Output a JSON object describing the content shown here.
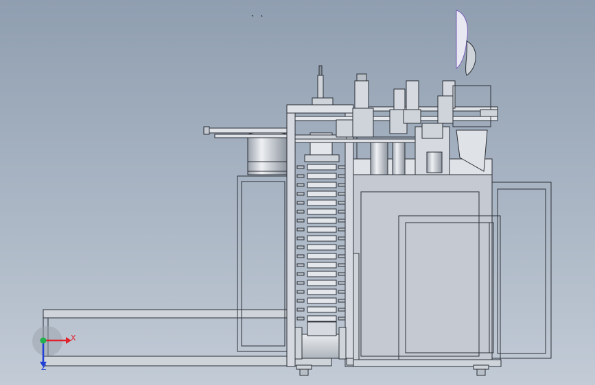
{
  "viewport": {
    "background_top": "#8f9eb0",
    "background_bottom": "#c2cbd6"
  },
  "triad": {
    "x_label": "X",
    "z_label": "Z",
    "x_color": "#e0202a",
    "z_color": "#1f3fd6",
    "origin_color": "#22b14c"
  },
  "model": {
    "line_color": "#2b2f36",
    "fill_light": "#d6dae0",
    "fill_mid": "#c5cad2",
    "fill_dark": "#9aa1ab",
    "highlight": "#eef0f3",
    "accent_purple": "#7a5db8"
  }
}
